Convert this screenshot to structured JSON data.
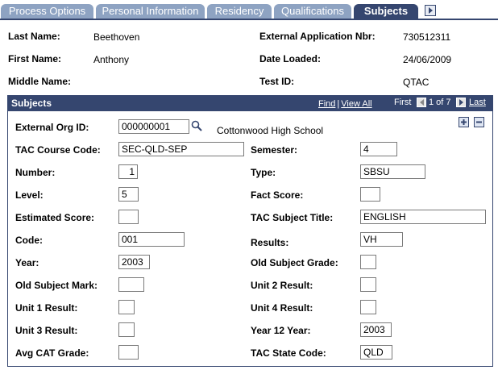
{
  "tabs": [
    {
      "label": "Process Options",
      "active": false
    },
    {
      "label": "Personal Information",
      "active": false
    },
    {
      "label": "Residency",
      "active": false
    },
    {
      "label": "Qualifications",
      "active": false
    },
    {
      "label": "Subjects",
      "active": true
    }
  ],
  "header": {
    "last_name_label": "Last Name:",
    "last_name": "Beethoven",
    "first_name_label": "First Name:",
    "first_name": "Anthony",
    "middle_name_label": "Middle Name:",
    "middle_name": "",
    "ext_app_label": "External Application Nbr:",
    "ext_app": "730512311",
    "date_loaded_label": "Date Loaded:",
    "date_loaded": "24/06/2009",
    "test_id_label": "Test ID:",
    "test_id": "QTAC"
  },
  "grid": {
    "title": "Subjects",
    "find": "Find",
    "view_all": "View All",
    "separator": "|",
    "first": "First",
    "position": "1 of 7",
    "last": "Last"
  },
  "fields": {
    "ext_org_id_label": "External Org ID:",
    "ext_org_id": "000000001",
    "org_name": "Cottonwood High School",
    "tac_course_code_label": "TAC Course Code:",
    "tac_course_code": "SEC-QLD-SEP",
    "semester_label": "Semester:",
    "semester": "4",
    "number_label": "Number:",
    "number": "1",
    "type_label": "Type:",
    "type": "SBSU",
    "level_label": "Level:",
    "level": "5",
    "fact_score_label": "Fact Score:",
    "fact_score": "",
    "estimated_score_label": "Estimated Score:",
    "estimated_score": "",
    "tac_subject_title_label": "TAC Subject Title:",
    "tac_subject_title": "ENGLISH",
    "code_label": "Code:",
    "code": "001",
    "results_label": "Results:",
    "results": "VH",
    "year_label": "Year:",
    "year": "2003",
    "old_subject_grade_label": "Old Subject Grade:",
    "old_subject_grade": "",
    "old_subject_mark_label": "Old Subject Mark:",
    "old_subject_mark": "",
    "unit2_result_label": "Unit 2 Result:",
    "unit2_result": "",
    "unit1_result_label": "Unit 1 Result:",
    "unit1_result": "",
    "unit4_result_label": "Unit 4 Result:",
    "unit4_result": "",
    "unit3_result_label": "Unit 3 Result:",
    "unit3_result": "",
    "year12_year_label": "Year 12 Year:",
    "year12_year": "2003",
    "avg_cat_grade_label": "Avg CAT Grade:",
    "avg_cat_grade": "",
    "tac_state_code_label": "TAC State Code:",
    "tac_state_code": "QLD"
  },
  "colors": {
    "tab_inactive": "#8ea3c2",
    "tab_active": "#35466f",
    "grid_header": "#35466f"
  },
  "icons": {
    "lookup": "magnifier-icon",
    "add_row": "plus-icon",
    "delete_row": "minus-icon",
    "tab_next": "arrow-right-icon",
    "nav_prev": "arrow-left-icon",
    "nav_next": "arrow-right-icon"
  }
}
